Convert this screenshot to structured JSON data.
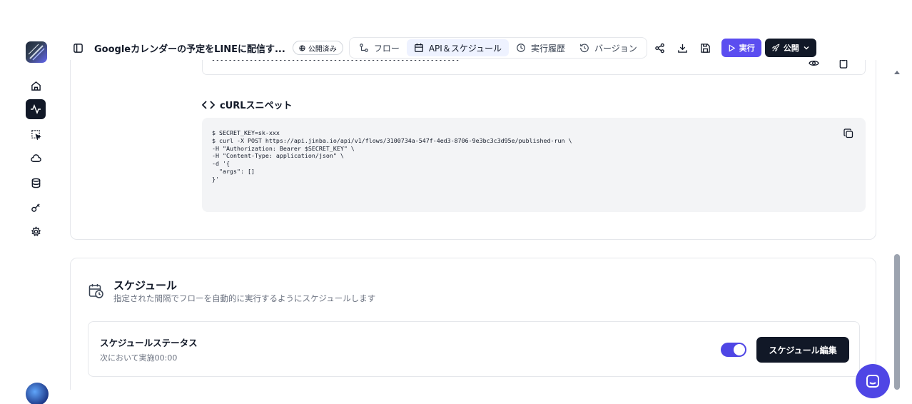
{
  "topbar": {
    "title": "Googleカレンダーの予定をLINEに配信す...",
    "published_badge": "公開済み",
    "tabs": [
      {
        "label": "フロー",
        "icon": "flow-icon"
      },
      {
        "label": "API＆スケジュール",
        "icon": "calendar-icon"
      },
      {
        "label": "実行履歴",
        "icon": "clock-icon"
      },
      {
        "label": "バージョン",
        "icon": "history-icon"
      }
    ],
    "run_label": "実行",
    "publish_label": "公開"
  },
  "api": {
    "secret_masked": "•••••••••••••••••••••••••••••••••••••••••••••••••••••••••••",
    "curl_heading": "cURLスニペット",
    "curl_code": "$ SECRET_KEY=sk-xxx\n$ curl -X POST https://api.jinba.io/api/v1/flows/3100734a-547f-4ed3-8706-9e3bc3c3d95e/published-run \\\n-H \"Authorization: Bearer $SECRET_KEY\" \\\n-H \"Content-Type: application/json\" \\\n-d '{\n  \"args\": []\n}'"
  },
  "schedule": {
    "title": "スケジュール",
    "description": "指定された間隔でフローを自動的に実行するようにスケジュールします",
    "status_title": "スケジュールステータス",
    "status_sub": "次において実施00:00",
    "enabled": true,
    "edit_label": "スケジュール編集"
  },
  "colors": {
    "accent": "#4f46e5",
    "run": "#5b4df0",
    "dark": "#111827"
  }
}
